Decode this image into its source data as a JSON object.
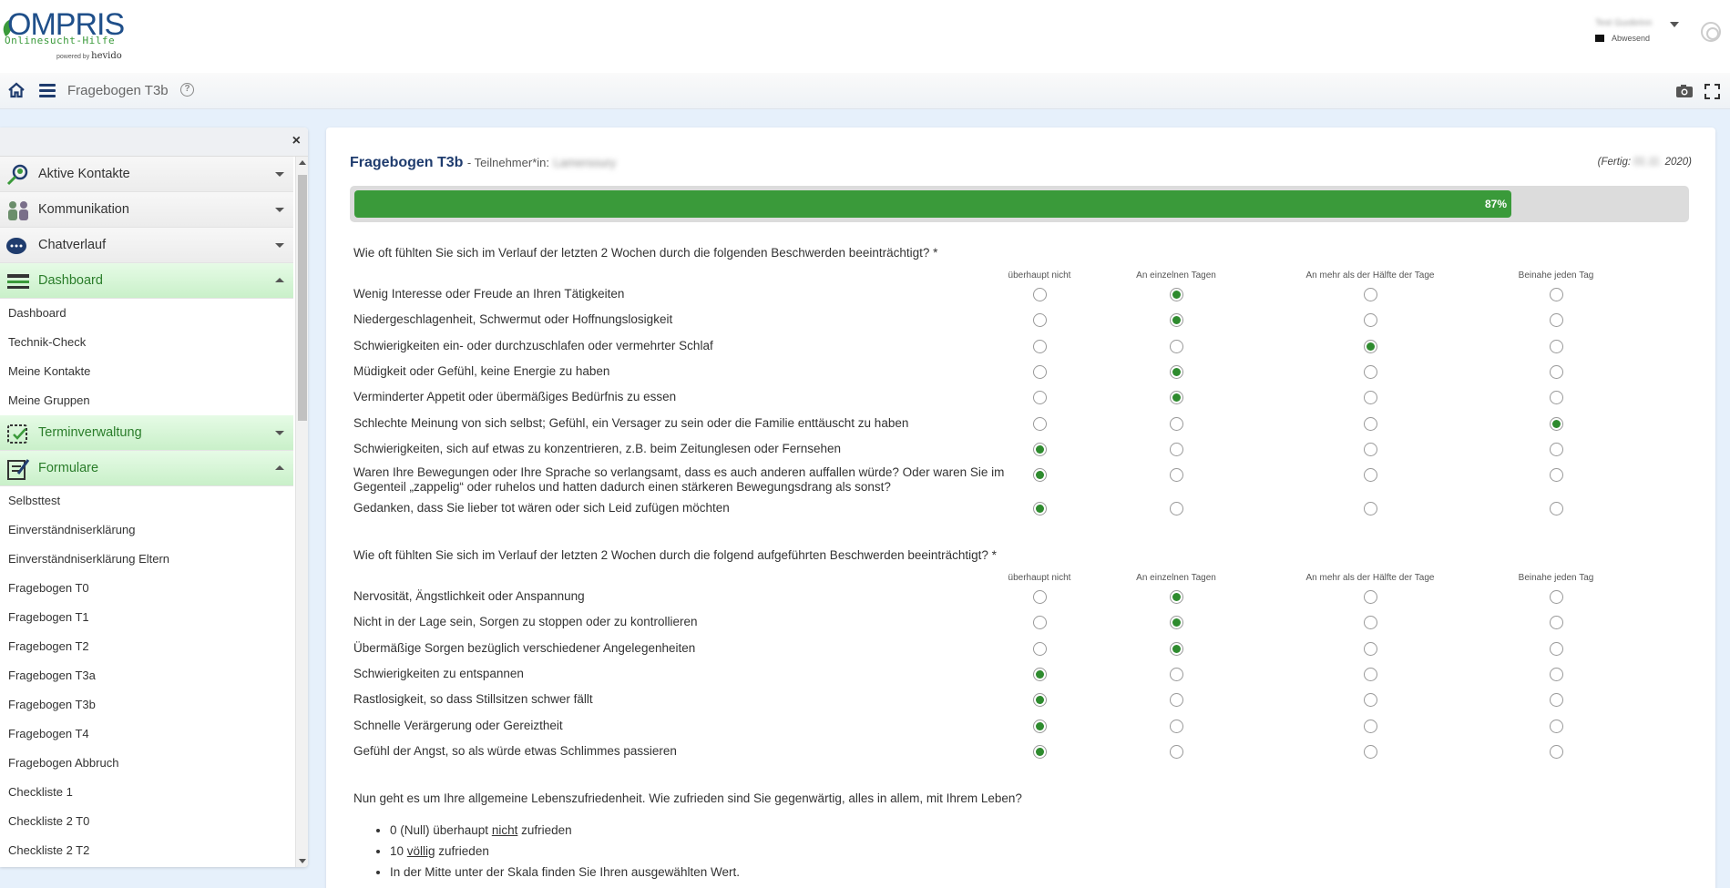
{
  "header": {
    "logo_text": "OMPRIS",
    "logo_sub": "Onlinesucht-Hilfe",
    "logo_powered": "powered by",
    "logo_powered_brand": "hevido",
    "user_name": "Test Guobrinn",
    "user_status": "Abwesend"
  },
  "navbar": {
    "title": "Fragebogen T3b",
    "help": "?"
  },
  "sidebar": {
    "close": "×",
    "groups": [
      {
        "label": "Aktive Kontakte",
        "icon": "search-person-icon",
        "active": false,
        "expanded": false
      },
      {
        "label": "Kommunikation",
        "icon": "people-icon",
        "active": false,
        "expanded": false
      },
      {
        "label": "Chatverlauf",
        "icon": "chat-icon",
        "active": false,
        "expanded": false
      },
      {
        "label": "Dashboard",
        "icon": "dashboard-icon",
        "active": true,
        "expanded": true,
        "items": [
          "Dashboard",
          "Technik-Check",
          "Meine Kontakte",
          "Meine Gruppen"
        ]
      },
      {
        "label": "Terminverwaltung",
        "icon": "calendar-icon",
        "active": true,
        "expanded": false
      },
      {
        "label": "Formulare",
        "icon": "form-icon",
        "active": true,
        "expanded": true,
        "items": [
          "Selbsttest",
          "Einverständniserklärung",
          "Einverständniserklärung Eltern",
          "Fragebogen T0",
          "Fragebogen T1",
          "Fragebogen T2",
          "Fragebogen T3a",
          "Fragebogen T3b",
          "Fragebogen T4",
          "Fragebogen Abbruch",
          "Checkliste 1",
          "Checkliste 2 T0",
          "Checkliste 2 T2"
        ]
      }
    ]
  },
  "form": {
    "title": "Fragebogen T3b",
    "participant_label": "- Teilnehmer*in:",
    "participant_name": "Lamersoury",
    "done_label": "(Fertig:",
    "done_date_blur": "01.11.",
    "done_year": "2020)",
    "progress_value": 87,
    "progress_text": "87%",
    "columns": [
      "überhaupt nicht",
      "An einzelnen Tagen",
      "An mehr als der Hälfte der Tage",
      "Beinahe jeden Tag"
    ],
    "section1": {
      "question": "Wie oft fühlten Sie sich im Verlauf der letzten 2 Wochen durch die folgenden Beschwerden beeinträchtigt? *",
      "rows": [
        {
          "label": "Wenig Interesse oder Freude an Ihren Tätigkeiten",
          "selected": 1
        },
        {
          "label": "Niedergeschlagenheit, Schwermut oder Hoffnungslosigkeit",
          "selected": 1
        },
        {
          "label": "Schwierigkeiten ein- oder durchzuschlafen oder vermehrter Schlaf",
          "selected": 2
        },
        {
          "label": "Müdigkeit oder Gefühl, keine Energie zu haben",
          "selected": 1
        },
        {
          "label": "Verminderter Appetit oder übermäßiges Bedürfnis zu essen",
          "selected": 1
        },
        {
          "label": "Schlechte Meinung von sich selbst; Gefühl, ein Versager zu sein oder die Familie enttäuscht zu haben",
          "selected": 3
        },
        {
          "label": "Schwierigkeiten, sich auf etwas zu konzentrieren, z.B. beim Zeitunglesen oder Fernsehen",
          "selected": 0
        },
        {
          "label": "Waren Ihre Bewegungen oder Ihre Sprache so verlangsamt, dass es auch anderen auffallen würde? Oder waren Sie im Gegenteil „zappelig“ oder ruhelos und hatten dadurch einen stärkeren Bewegungsdrang als sonst?",
          "selected": 0
        },
        {
          "label": "Gedanken, dass Sie lieber tot wären oder sich Leid zufügen möchten",
          "selected": 0
        }
      ]
    },
    "section2": {
      "question": "Wie oft fühlten Sie sich im Verlauf der letzten 2 Wochen durch die folgend aufgeführten Beschwerden beeinträchtigt?  *",
      "rows": [
        {
          "label": "Nervosität, Ängstlichkeit oder Anspannung",
          "selected": 1
        },
        {
          "label": "Nicht in der Lage sein, Sorgen zu stoppen oder zu kontrollieren",
          "selected": 1
        },
        {
          "label": "Übermäßige Sorgen bezüglich verschiedener Angelegenheiten",
          "selected": 1
        },
        {
          "label": "Schwierigkeiten zu entspannen",
          "selected": 0
        },
        {
          "label": "Rastlosigkeit, so dass Stillsitzen schwer fällt",
          "selected": 0
        },
        {
          "label": "Schnelle Verärgerung oder Gereiztheit",
          "selected": 0
        },
        {
          "label": "Gefühl der Angst, so als würde etwas Schlimmes passieren",
          "selected": 0
        }
      ]
    },
    "section3": {
      "question": "Nun geht es um Ihre allgemeine Lebenszufriedenheit. Wie zufrieden sind Sie gegenwärtig, alles in allem, mit Ihrem Leben?",
      "b1_a": "0 (Null) überhaupt ",
      "b1_u": "nicht",
      "b1_b": " zufrieden",
      "b2_a": "10 ",
      "b2_u": "völlig",
      "b2_b": " zufrieden",
      "b3": "In der Mitte unter der Skala finden Sie Ihren ausgewählten Wert."
    }
  },
  "colors": {
    "brand_blue": "#1f3c6e",
    "green": "#3a9a3a",
    "active_bg": "#c9f0c9"
  }
}
